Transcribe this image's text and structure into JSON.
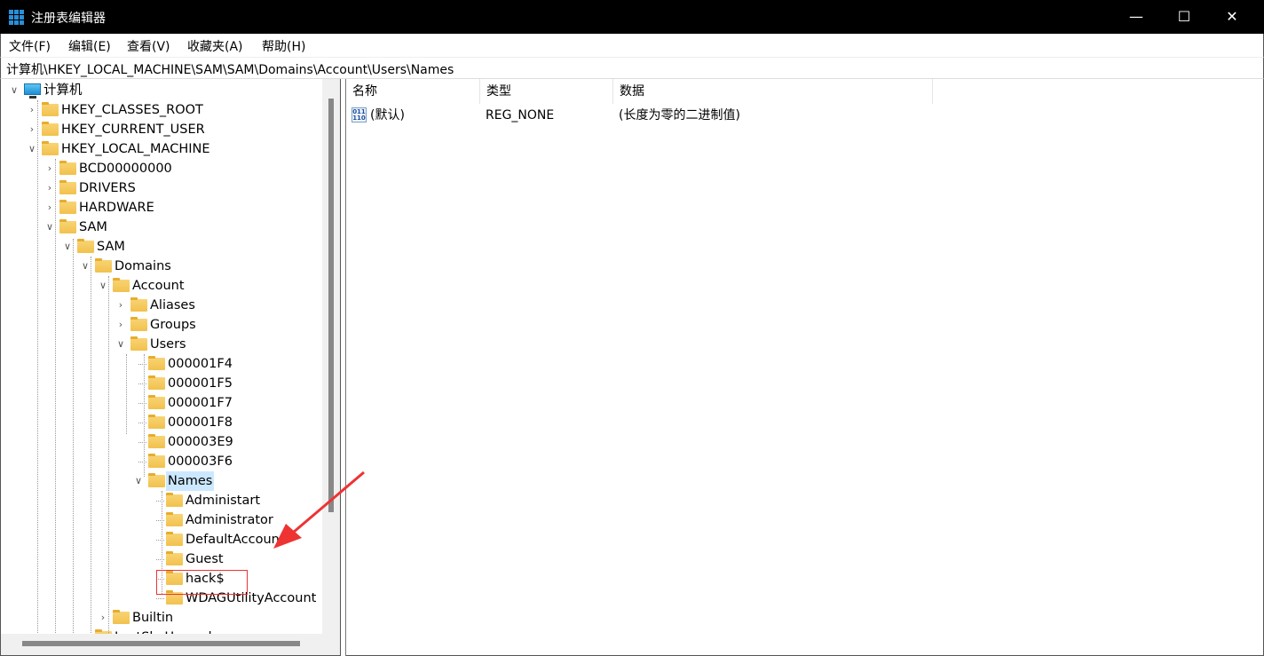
{
  "window": {
    "title": "注册表编辑器",
    "minimize": "—",
    "maximize": "☐",
    "close": "✕",
    "accent": "#2a8fd8"
  },
  "menu": [
    "文件(F)",
    "编辑(E)",
    "查看(V)",
    "收藏夹(A)",
    "帮助(H)"
  ],
  "address": "计算机\\HKEY_LOCAL_MACHINE\\SAM\\SAM\\Domains\\Account\\Users\\Names",
  "tree": [
    {
      "label": "计算机",
      "level": 0,
      "state": "open",
      "icon": "computer-icon"
    },
    {
      "label": "HKEY_CLASSES_ROOT",
      "level": 1,
      "state": "closed"
    },
    {
      "label": "HKEY_CURRENT_USER",
      "level": 1,
      "state": "closed"
    },
    {
      "label": "HKEY_LOCAL_MACHINE",
      "level": 1,
      "state": "open"
    },
    {
      "label": "BCD00000000",
      "level": 2,
      "state": "closed"
    },
    {
      "label": "DRIVERS",
      "level": 2,
      "state": "closed"
    },
    {
      "label": "HARDWARE",
      "level": 2,
      "state": "closed"
    },
    {
      "label": "SAM",
      "level": 2,
      "state": "open"
    },
    {
      "label": "SAM",
      "level": 3,
      "state": "open"
    },
    {
      "label": "Domains",
      "level": 4,
      "state": "open"
    },
    {
      "label": "Account",
      "level": 5,
      "state": "open"
    },
    {
      "label": "Aliases",
      "level": 6,
      "state": "closed"
    },
    {
      "label": "Groups",
      "level": 6,
      "state": "closed"
    },
    {
      "label": "Users",
      "level": 6,
      "state": "open"
    },
    {
      "label": "000001F4",
      "level": 7,
      "state": "leaf"
    },
    {
      "label": "000001F5",
      "level": 7,
      "state": "leaf"
    },
    {
      "label": "000001F7",
      "level": 7,
      "state": "leaf"
    },
    {
      "label": "000001F8",
      "level": 7,
      "state": "leaf"
    },
    {
      "label": "000003E9",
      "level": 7,
      "state": "leaf"
    },
    {
      "label": "000003F6",
      "level": 7,
      "state": "leaf"
    },
    {
      "label": "Names",
      "level": 7,
      "state": "open",
      "selected": true
    },
    {
      "label": "Administart",
      "level": 8,
      "state": "leaf"
    },
    {
      "label": "Administrator",
      "level": 8,
      "state": "leaf"
    },
    {
      "label": "DefaultAccount",
      "level": 8,
      "state": "leaf"
    },
    {
      "label": "Guest",
      "level": 8,
      "state": "leaf"
    },
    {
      "label": "hack$",
      "level": 8,
      "state": "leaf",
      "highlighted": true
    },
    {
      "label": "WDAGUtilityAccount",
      "level": 8,
      "state": "leaf"
    },
    {
      "label": "Builtin",
      "level": 5,
      "state": "closed"
    },
    {
      "label": "LastSkuUpgrade",
      "level": 4,
      "state": "leaf"
    }
  ],
  "list": {
    "columns": [
      "名称",
      "类型",
      "数据"
    ],
    "rows": [
      {
        "name": "(默认)",
        "type": "REG_NONE",
        "data": "(长度为零的二进制值)",
        "icon": "binary-value-icon"
      }
    ]
  },
  "annotation": {
    "color": "#e33",
    "arrow": "red-arrow-pointing-to-hack$"
  }
}
